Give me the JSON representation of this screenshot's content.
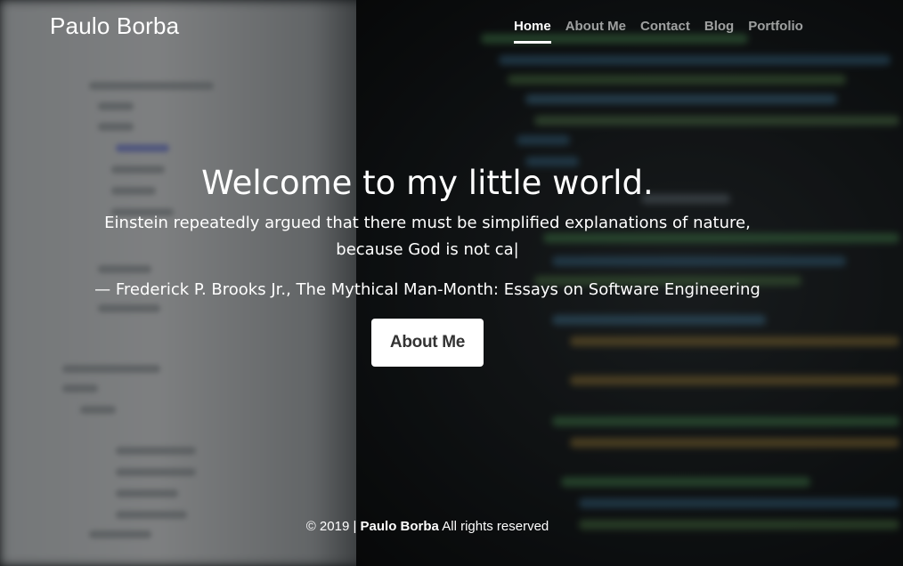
{
  "brand": {
    "name": "Paulo Borba"
  },
  "nav": {
    "items": [
      {
        "label": "Home",
        "active": true
      },
      {
        "label": "About Me",
        "active": false
      },
      {
        "label": "Contact",
        "active": false
      },
      {
        "label": "Blog",
        "active": false
      },
      {
        "label": "Portfolio",
        "active": false
      }
    ]
  },
  "hero": {
    "title": "Welcome to my little world.",
    "quote": "Einstein repeatedly argued that there must be simplified explanations of nature, because God is not ca|",
    "author": "— Frederick P. Brooks Jr., The Mythical Man-Month: Essays on Software Engineering",
    "cta_label": "About Me"
  },
  "footer": {
    "copyright": "© 2019 |",
    "owner": "Paulo Borba",
    "rights": "All rights reserved"
  },
  "colors": {
    "text": "#ffffff",
    "nav_inactive": "rgba(255,255,255,0.6)",
    "button_bg": "#ffffff",
    "button_text": "#333333"
  }
}
